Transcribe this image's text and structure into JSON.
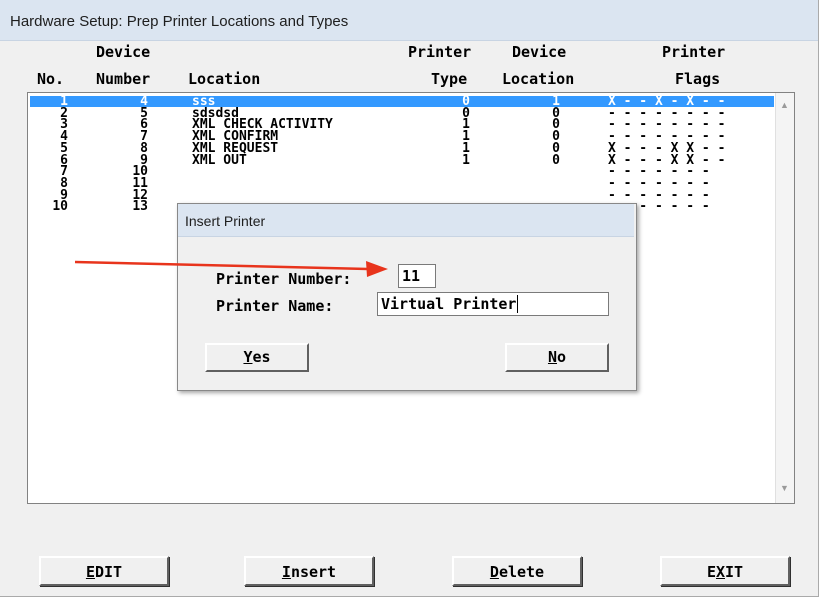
{
  "window": {
    "title": "Hardware Setup:  Prep Printer Locations and Types"
  },
  "headers": {
    "no": "No.",
    "device_top": "Device",
    "device_bottom": "Number",
    "location": "Location",
    "printer_type_top": "Printer",
    "printer_type_bottom": "Type",
    "device_location_top": "Device",
    "device_location_bottom": "Location",
    "flags_top": "Printer",
    "flags_bottom": "Flags"
  },
  "rows": [
    {
      "no": "1",
      "device": "4",
      "location": "sss",
      "type": "0",
      "dloc": "1",
      "flags": "X - - X - X - -",
      "selected": true
    },
    {
      "no": "2",
      "device": "5",
      "location": "sdsdsd",
      "type": "0",
      "dloc": "0",
      "flags": "- - - - - - - -"
    },
    {
      "no": "3",
      "device": "6",
      "location": "XML CHECK ACTIVITY",
      "type": "1",
      "dloc": "0",
      "flags": "- - - - - - - -"
    },
    {
      "no": "4",
      "device": "7",
      "location": "XML CONFIRM",
      "type": "1",
      "dloc": "0",
      "flags": "- - - - - - - -"
    },
    {
      "no": "5",
      "device": "8",
      "location": "XML REQUEST",
      "type": "1",
      "dloc": "0",
      "flags": "X - - - X X - -"
    },
    {
      "no": "6",
      "device": "9",
      "location": "XML OUT",
      "type": "1",
      "dloc": "0",
      "flags": "X - - - X X - -"
    },
    {
      "no": "7",
      "device": "10",
      "location": "",
      "type": "",
      "dloc": "",
      "flags": "- - - - - - -"
    },
    {
      "no": "8",
      "device": "11",
      "location": "",
      "type": "",
      "dloc": "",
      "flags": "- - - - - - -"
    },
    {
      "no": "9",
      "device": "12",
      "location": "",
      "type": "",
      "dloc": "",
      "flags": "- - - - - - -"
    },
    {
      "no": "10",
      "device": "13",
      "location": "",
      "type": "",
      "dloc": "",
      "flags": "- - - - - - -"
    }
  ],
  "buttons": {
    "edit": {
      "accel": "E",
      "rest": "DIT"
    },
    "insert": {
      "accel": "I",
      "rest": "nsert"
    },
    "delete": {
      "accel": "D",
      "rest": "elete"
    },
    "exit": {
      "pre": "E",
      "accel": "X",
      "rest": "IT"
    }
  },
  "dialog": {
    "title": "Insert Printer",
    "number_label": "Printer Number:",
    "number_value": "11",
    "name_label": "Printer Name:",
    "name_value": "Virtual Printer",
    "yes": {
      "accel": "Y",
      "rest": "es"
    },
    "no": {
      "accel": "N",
      "rest": "o"
    }
  },
  "colors": {
    "selection": "#3399ff",
    "arrow": "#e8341c",
    "titlebar": "#dbe5f1"
  }
}
